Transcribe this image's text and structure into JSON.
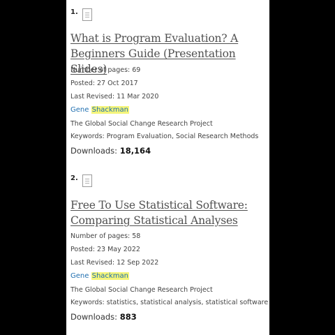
{
  "results": [
    {
      "number": "1.",
      "title_line1": "What is Program Evaluation? A",
      "title_line2": "Beginners Guide (Presentation Slides)",
      "pages": "Number of pages: 69",
      "posted": "Posted: 27 Oct 2017",
      "revised": "Last Revised: 11 Mar 2020",
      "author_first": "Gene",
      "author_last": "Shackman",
      "affiliation": "The Global Social Change Research Project",
      "keywords": "Keywords: Program Evaluation, Social Research Methods",
      "downloads_label": "Downloads:",
      "downloads_value": "18,164"
    },
    {
      "number": "2.",
      "title_line1": "Free To Use Statistical Software:",
      "title_line2": "Comparing Statistical Analyses",
      "pages": "Number of pages: 58",
      "posted": "Posted: 23 May 2022",
      "revised": "Last Revised: 12 Sep 2022",
      "author_first": "Gene",
      "author_last": "Shackman",
      "affiliation": "The Global Social Change Research Project",
      "keywords": "Keywords: statistics, statistical analysis, statistical software",
      "downloads_label": "Downloads:",
      "downloads_value": "883"
    }
  ]
}
